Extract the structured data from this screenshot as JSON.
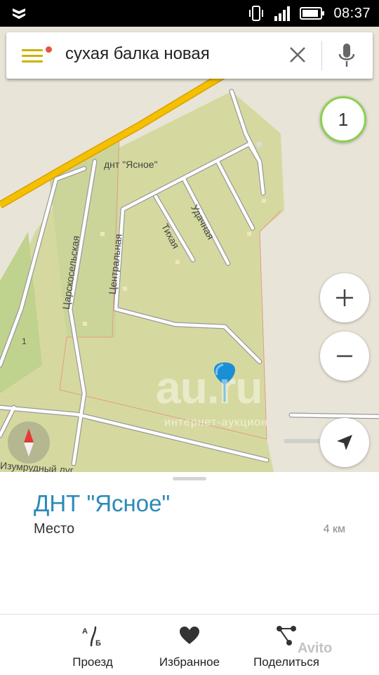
{
  "status_bar": {
    "time": "08:37",
    "icons": [
      "shield-icon",
      "vibrate-icon",
      "signal-icon",
      "battery-icon"
    ]
  },
  "search": {
    "query": "сухая балка новая",
    "menu_icon": "menu-icon",
    "clear_icon": "close-icon",
    "mic_icon": "microphone-icon"
  },
  "map": {
    "result_count": "1",
    "labels": {
      "area": "днт \"Ясное\"",
      "street_tsarskoselskaya": "Царскосельская",
      "street_tikhaya": "Тихая",
      "street_udachnaya": "Удачная",
      "street_tsentralnaya": "Центральная",
      "street_izumrudny": "Изумрудный луг",
      "house_number": "1"
    },
    "watermark": "au.ru",
    "watermark_sub": "интернет-аукцион",
    "colors": {
      "land": "#d9dca6",
      "green_area": "#b9cc8e",
      "road": "#ffffff",
      "highway": "#f5b800",
      "pin": "#1a8fd6"
    }
  },
  "place": {
    "title": "ДНТ \"Ясное\"",
    "type": "Место",
    "distance": "4 км"
  },
  "actions": [
    {
      "label": "Проезд",
      "icon": "route-icon"
    },
    {
      "label": "Избранное",
      "icon": "heart-icon"
    },
    {
      "label": "Поделиться",
      "icon": "share-icon"
    }
  ],
  "watermark_brand": "Avito"
}
